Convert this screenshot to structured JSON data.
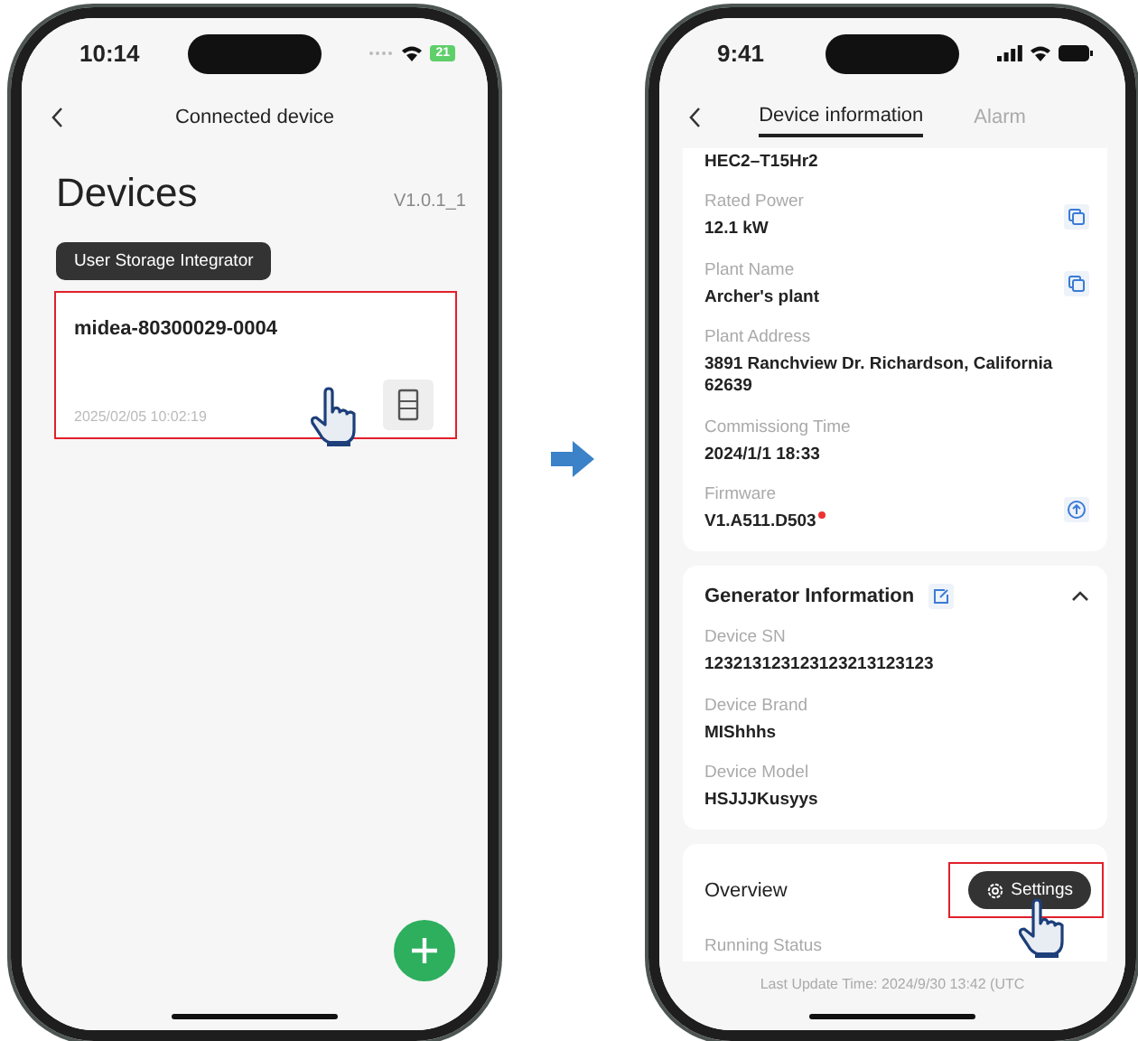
{
  "left_screen": {
    "status_bar": {
      "time": "10:14",
      "battery": "21"
    },
    "header": {
      "title": "Connected device"
    },
    "page_title": "Devices",
    "version": "V1.0.1_1",
    "role_badge": "User Storage Integrator",
    "devices": [
      {
        "name": "midea-80300029-0004",
        "time": "2025/02/05 10:02:19",
        "highlighted": true,
        "tapped": true
      }
    ]
  },
  "right_screen": {
    "status_bar": {
      "time": "9:41"
    },
    "tabs": [
      {
        "label": "Device information",
        "selected": true
      },
      {
        "label": "Alarm",
        "selected": false
      }
    ],
    "info_fields": [
      {
        "value": "HEC2–T15Hr2",
        "kind": "plain",
        "new": false
      },
      {
        "label": "Rated Power",
        "value": "12.1 kW",
        "kind": "copyable",
        "new": false
      },
      {
        "label": "Plant Name",
        "value": "Archer's plant",
        "kind": "copyable",
        "new": false
      },
      {
        "label": "Plant Address",
        "value": "3891 Ranchview Dr. Richardson, California 62639",
        "kind": "plain",
        "new": false
      },
      {
        "label": "Commissiong Time",
        "value": "2024/1/1 18:33",
        "kind": "plain",
        "new": false
      },
      {
        "label": "Firmware",
        "value": "V1.A511.D503",
        "kind": "upgradable",
        "new": true
      }
    ],
    "generator": {
      "title": "Generator Information",
      "expanded": true,
      "fields": [
        {
          "label": "Device SN",
          "value": "123213123123123213123123"
        },
        {
          "label": "Device Brand",
          "value": "MIShhhs"
        },
        {
          "label": "Device Model",
          "value": "HSJJJKusyys"
        }
      ]
    },
    "overview": {
      "title": "Overview",
      "settings_button": {
        "label": "Settings",
        "highlighted": true,
        "tapped": true
      },
      "first_label": "Running Status"
    },
    "footer": "Last Update Time: 2024/9/30 13:42 (UTC"
  }
}
